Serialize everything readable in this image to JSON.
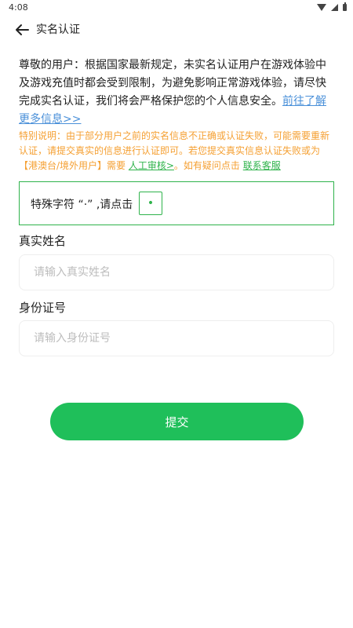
{
  "status": {
    "time": "4:08"
  },
  "header": {
    "title": "实名认证"
  },
  "intro": {
    "text": "尊敬的用户：根据国家最新规定，未实名认证用户在游戏体验中及游戏充值时都会受到限制，为避免影响正常游戏体验，请尽快完成实名认证，我们将会严格保护您的个人信息安全。",
    "link": "前往了解更多信息>>"
  },
  "note": {
    "text": "特别说明：由于部分用户之前的实名信息不正确或认证失败，可能需要重新认证，请提交真实的信息进行认证即可。若您提交真实信息认证失败或为【港澳台/境外用户】需要 ",
    "review_link": "人工审核>",
    "middle": "。如有疑问点击 ",
    "service_link": "联系客服"
  },
  "special": {
    "label": "特殊字符 “·” ,请点击",
    "button": "•"
  },
  "form": {
    "name_label": "真实姓名",
    "name_placeholder": "请输入真实姓名",
    "id_label": "身份证号",
    "id_placeholder": "请输入身份证号"
  },
  "submit_label": "提交",
  "colors": {
    "accent": "#1fbf5a",
    "note": "#f5a033",
    "link": "#4a90d9"
  },
  "icons": [
    "wifi-icon",
    "signal-icon",
    "battery-icon",
    "back-arrow-icon"
  ]
}
